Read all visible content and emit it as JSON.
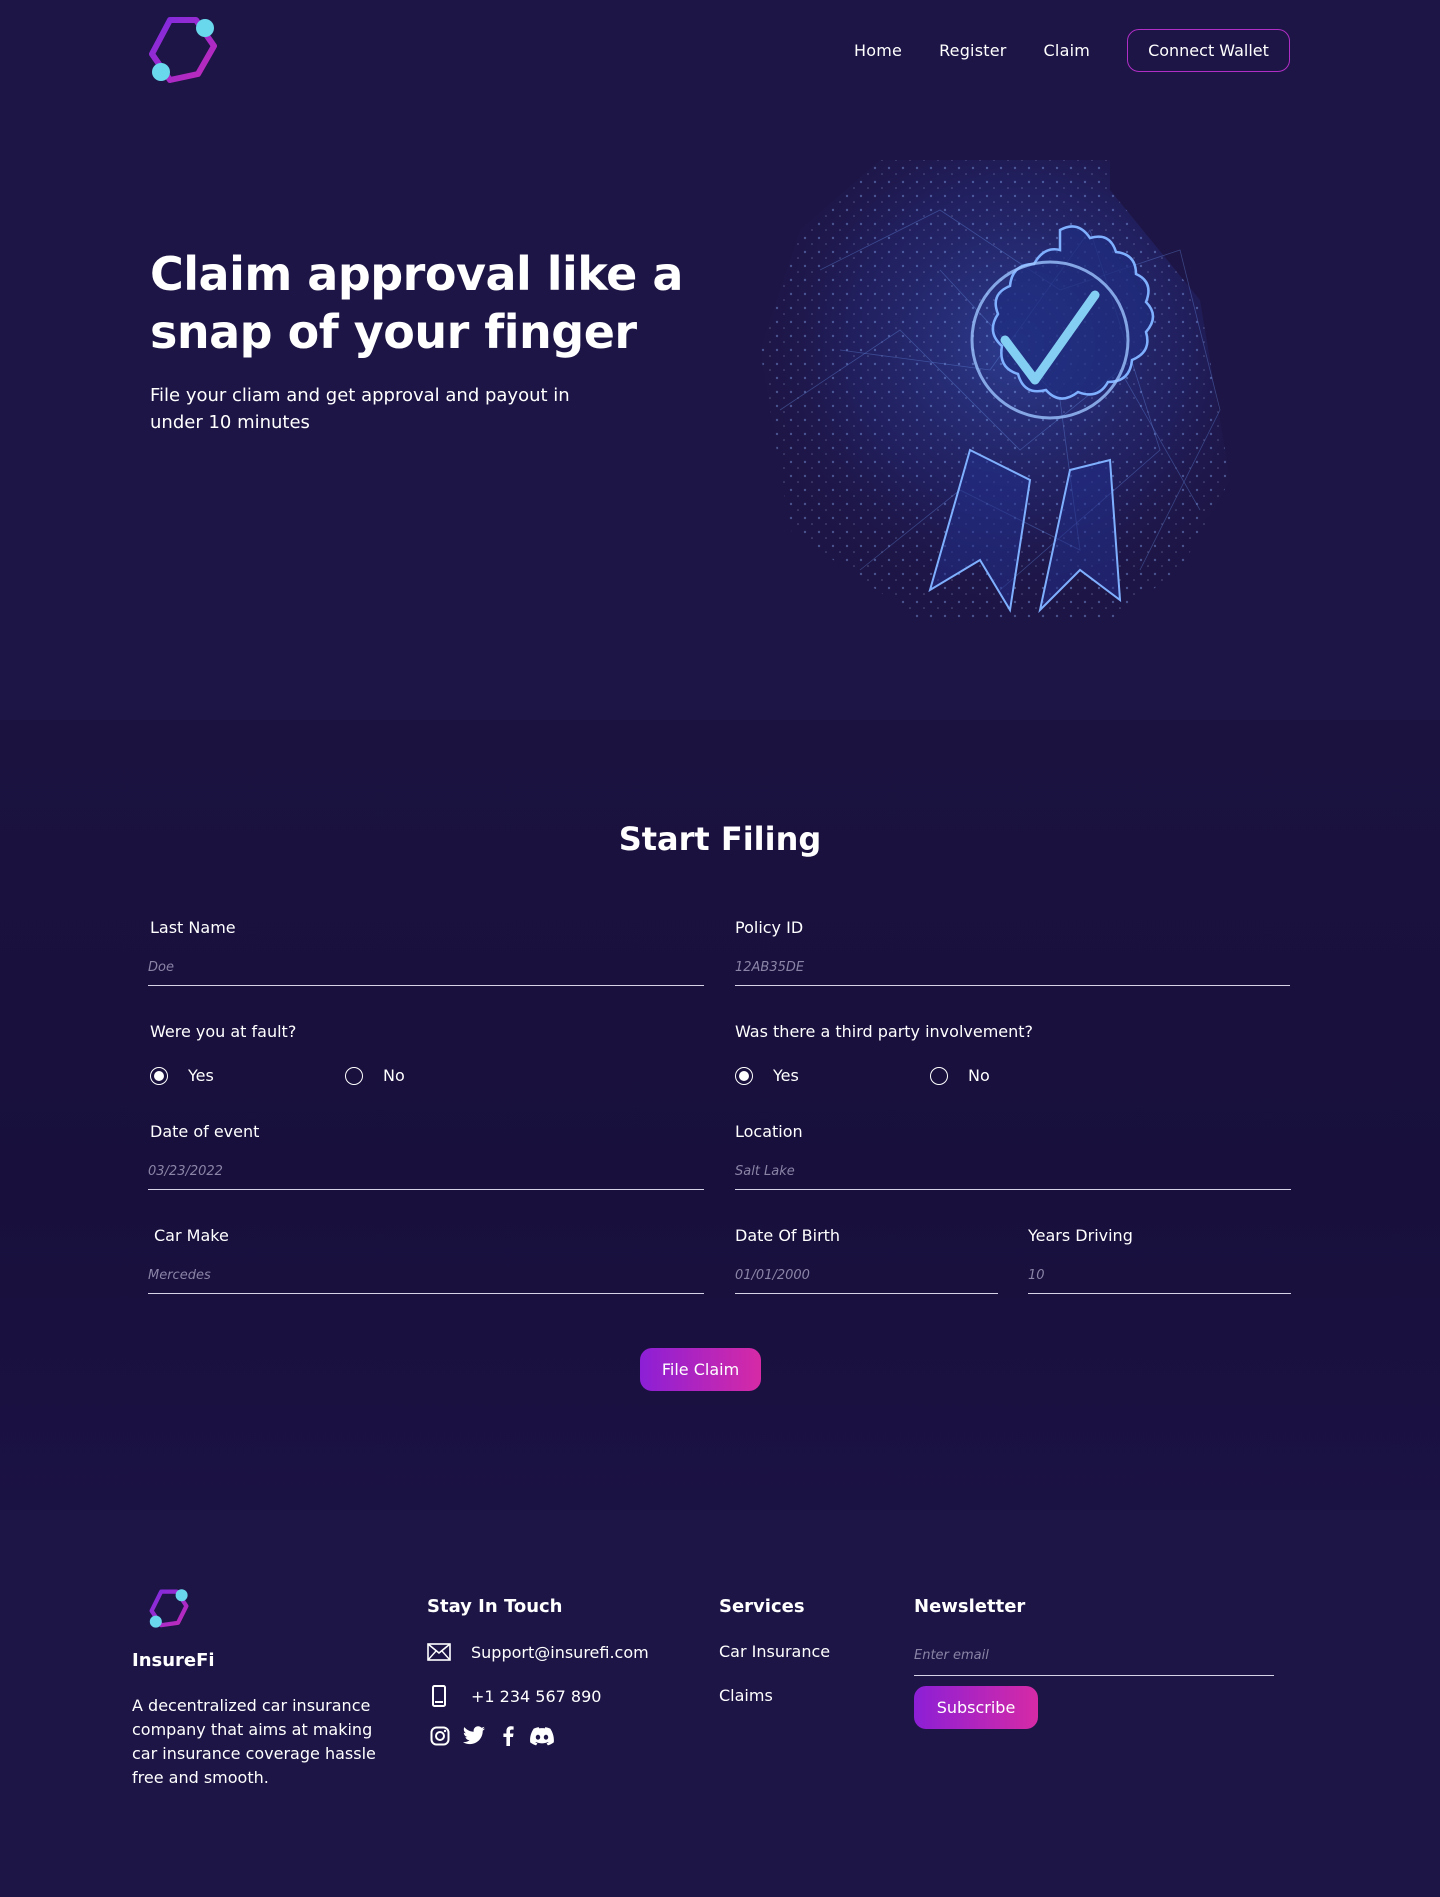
{
  "nav": {
    "logo_icon": "hexagon-logo-icon",
    "links": [
      "Home",
      "Register",
      "Claim"
    ],
    "connect_wallet": "Connect Wallet"
  },
  "hero": {
    "title_line1": "Claim approval like a",
    "title_line2": "snap of your finger",
    "subtitle_line1": "File your cliam and get approval and payout in",
    "subtitle_line2": "under 10 minutes",
    "art_icon": "approval-badge-icon"
  },
  "form": {
    "title": "Start Filing",
    "last_name": {
      "label": "Last Name",
      "placeholder": "Doe"
    },
    "policy_id": {
      "label": "Policy ID",
      "placeholder": "12AB35DE"
    },
    "fault": {
      "label": "Were you at fault?",
      "yes": "Yes",
      "no": "No",
      "selected": "Yes"
    },
    "third_party": {
      "label": "Was there a third party involvement?",
      "yes": "Yes",
      "no": "No",
      "selected": "Yes"
    },
    "date_of_event": {
      "label": "Date of event",
      "placeholder": "03/23/2022"
    },
    "location": {
      "label": "Location",
      "placeholder": "Salt Lake"
    },
    "car_make": {
      "label": "Car Make",
      "placeholder": "Mercedes"
    },
    "date_of_birth": {
      "label": "Date Of Birth",
      "placeholder": "01/01/2000"
    },
    "years_driving": {
      "label": "Years Driving",
      "placeholder": "10"
    },
    "submit": "File Claim"
  },
  "footer": {
    "brand": "InsureFi",
    "description": "A decentralized car insurance company that aims at making car insurance coverage hassle free and smooth.",
    "stay_in_touch": {
      "heading": "Stay In Touch",
      "email": "Support@insurefi.com",
      "phone": "+1 234 567 890",
      "socials": [
        "instagram-icon",
        "twitter-icon",
        "facebook-icon",
        "discord-icon"
      ]
    },
    "services": {
      "heading": "Services",
      "items": [
        "Car Insurance",
        "Claims"
      ]
    },
    "newsletter": {
      "heading": "Newsletter",
      "placeholder": "Enter email",
      "button": "Subscribe"
    }
  },
  "colors": {
    "background": "#1d1545",
    "form_background": "#180f3c",
    "accent_gradient_start": "#8c1fd6",
    "accent_gradient_end": "#d62aa6",
    "logo_cyan": "#6ad8ec",
    "logo_purple": "#9b2bd2"
  }
}
